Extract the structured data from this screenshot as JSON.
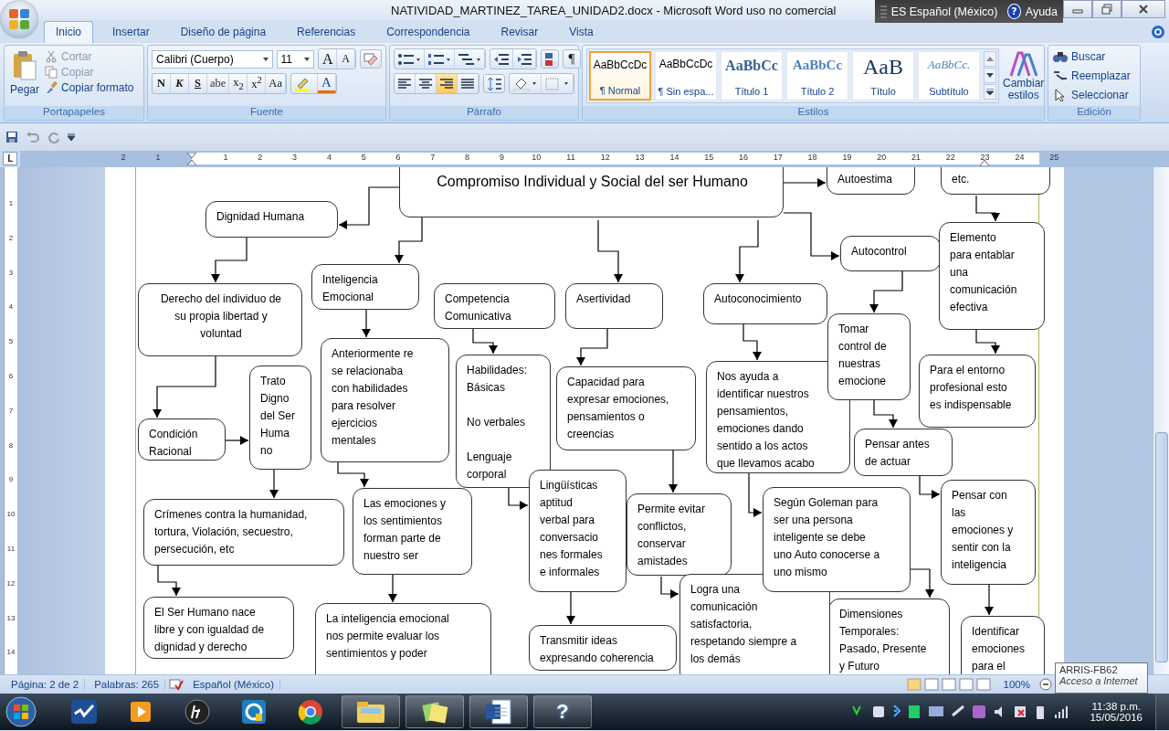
{
  "window": {
    "title": "NATIVIDAD_MARTINEZ_TAREA_UNIDAD2.docx - Microsoft Word uso no comercial"
  },
  "language_bar": {
    "language": "ES Español (México)",
    "help_glyph": "?",
    "help": "Ayuda"
  },
  "tabs": [
    {
      "label": "Inicio",
      "selected": true
    },
    {
      "label": "Insertar",
      "selected": false
    },
    {
      "label": "Diseño de página",
      "selected": false
    },
    {
      "label": "Referencias",
      "selected": false
    },
    {
      "label": "Correspondencia",
      "selected": false
    },
    {
      "label": "Revisar",
      "selected": false
    },
    {
      "label": "Vista",
      "selected": false
    }
  ],
  "ribbon": {
    "clipboard": {
      "title": "Portapapeles",
      "paste": "Pegar",
      "actions": [
        {
          "label": "Cortar",
          "disabled": true,
          "kind": "cut"
        },
        {
          "label": "Copiar",
          "disabled": true,
          "kind": "copy"
        },
        {
          "label": "Copiar formato",
          "disabled": false,
          "kind": "brush"
        }
      ]
    },
    "font": {
      "title": "Fuente",
      "family": "Calibri (Cuerpo)",
      "size": "11",
      "grow": "A",
      "shrink": "A",
      "format_buttons": [
        "N",
        "K",
        "S",
        "abe",
        "x$_{2}$",
        "x$^{2}$",
        "Aa"
      ],
      "color_button": "A"
    },
    "paragraph": {
      "title": "Párrafo",
      "alignments": [
        {
          "kind": "left",
          "selected": false
        },
        {
          "kind": "center",
          "selected": false
        },
        {
          "kind": "right",
          "selected": true
        },
        {
          "kind": "justify",
          "selected": false
        }
      ],
      "marks_button": "¶"
    },
    "styles": {
      "title": "Estilos",
      "items": [
        {
          "preview": "AaBbCcDc",
          "label": "¶ Normal",
          "kind": "normal",
          "selected": true
        },
        {
          "preview": "AaBbCcDc",
          "label": "¶ Sin espa...",
          "kind": "plain",
          "selected": false
        },
        {
          "preview": "AaBbCc",
          "label": "Título 1",
          "kind": "heading1",
          "selected": false
        },
        {
          "preview": "AaBbCc",
          "label": "Título 2",
          "kind": "heading2",
          "selected": false
        },
        {
          "preview": "AaB",
          "label": "Título",
          "kind": "title",
          "selected": false
        },
        {
          "preview": "AaBbCc.",
          "label": "Subtítulo",
          "kind": "subtitle",
          "selected": false
        }
      ],
      "change_styles": "Cambiar estilos"
    },
    "editing": {
      "title": "Edición",
      "items": [
        {
          "label": "Buscar",
          "kind": "find"
        },
        {
          "label": "Reemplazar",
          "kind": "replace"
        },
        {
          "label": "Seleccionar",
          "kind": "select"
        }
      ]
    }
  },
  "ruler": {
    "tab_selector": "L",
    "marks": [
      "2",
      "1",
      "1",
      "2",
      "3",
      "4",
      "5",
      "6",
      "7",
      "8",
      "9",
      "10",
      "11",
      "12",
      "13",
      "14",
      "15",
      "16",
      "17",
      "18",
      "19",
      "20",
      "21",
      "22",
      "23",
      "24",
      "25"
    ],
    "vertical_marks": [
      "1",
      "2",
      "3",
      "4",
      "5",
      "6",
      "7",
      "8",
      "9",
      "10",
      "11",
      "12",
      "13",
      "14"
    ]
  },
  "diagram": {
    "nodes": [
      {
        "text": "Compromiso Individual y Social del ser Humano"
      },
      {
        "text": "Autoestima"
      },
      {
        "text": "etc."
      },
      {
        "text": "Dignidad Humana"
      },
      {
        "text": "Inteligencia\nEmocional"
      },
      {
        "text": "Competencia\nComunicativa"
      },
      {
        "text": "Asertividad"
      },
      {
        "text": "Autoconocimiento"
      },
      {
        "text": "Autocontrol"
      },
      {
        "text": "Elemento\npara entablar\nuna\ncomunicación\nefectiva"
      },
      {
        "text": "Derecho del individuo de\nsu propia libertad y\nvoluntad"
      },
      {
        "text": "Anteriormente re\nse relacionaba\ncon habilidades\npara resolver\nejercicios\nmentales"
      },
      {
        "text": "Habilidades:\nBásicas\n\nNo verbales\n\nLenguaje\ncorporal"
      },
      {
        "text": "Capacidad para\nexpresar emociones,\npensamientos o\ncreencias"
      },
      {
        "text": "Nos ayuda a\nidentificar nuestros\npensamientos,\nemociones dando\nsentido a los actos\nque llevamos acabo"
      },
      {
        "text": "Tomar\ncontrol de\nnuestras\nemocione"
      },
      {
        "text": "Para el entorno\nprofesional esto\nes indispensable"
      },
      {
        "text": "Condición\nRacional"
      },
      {
        "text": "Trato\nDigno\ndel Ser\nHuma\nno"
      },
      {
        "text": "Pensar antes\nde actuar"
      },
      {
        "text": "Crímenes contra la humanidad,\ntortura, Violación, secuestro,\npersecución, etc"
      },
      {
        "text": "Las emociones y\nlos sentimientos\nforman parte de\nnuestro ser"
      },
      {
        "text": "Lingüísticas\naptitud\nverbal para\nconversacio\nnes formales\ne informales"
      },
      {
        "text": "Permite evitar\nconflictos,\nconservar\namistades"
      },
      {
        "text": "Según Goleman para\nser una persona\ninteligente se debe\nuno Auto conocerse a\nuno mismo"
      },
      {
        "text": "Pensar con\nlas\nemociones y\nsentir con la\ninteligencia"
      },
      {
        "text": "El Ser Humano nace\nlibre y con igualdad de\ndignidad y derecho"
      },
      {
        "text": "La inteligencia emocional\nnos permite evaluar los\nsentimientos y poder"
      },
      {
        "text": "Transmitir ideas\nexpresando coherencia"
      },
      {
        "text": "Logra una\ncomunicación\nsatisfactoria,\nrespetando siempre a\nlos demás"
      },
      {
        "text": "Dimensiones\nTemporales:\nPasado, Presente\ny Futuro"
      },
      {
        "text": "Identificar\nemociones\npara el"
      }
    ]
  },
  "status_bar": {
    "page": "Página: 2 de 2",
    "words": "Palabras: 265",
    "language": "Español (México)",
    "zoom": "100%"
  },
  "tooltip": {
    "title": "ARRIS-FB62",
    "text": "Acceso a Internet"
  },
  "taskbar": {
    "help_glyph": "?",
    "time": "11:38 p.m.",
    "date": "15/05/2016"
  }
}
